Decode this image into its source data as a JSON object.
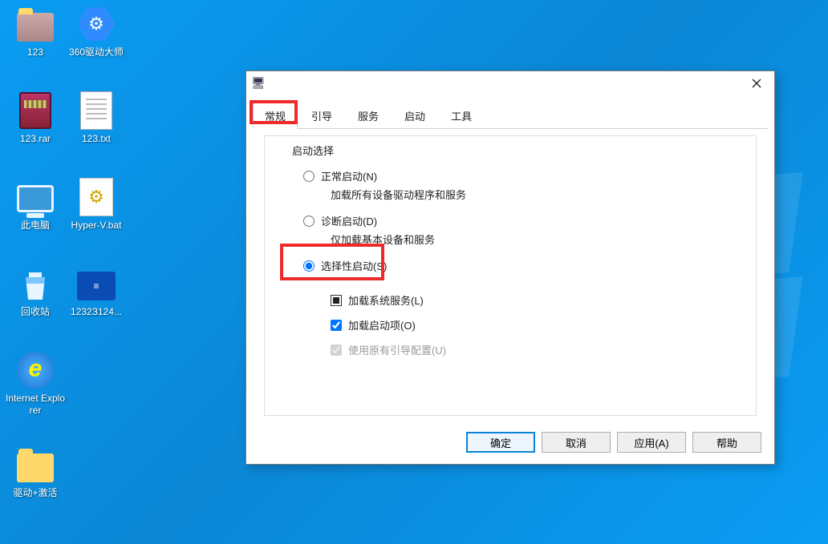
{
  "desktop_icons": {
    "folder123": "123",
    "driver360": "360驱动大师",
    "rar": "123.rar",
    "txt": "123.txt",
    "thispc": "此电脑",
    "hyperv": "Hyper-V.bat",
    "recycle": "回收站",
    "shortcut": "1232З124...",
    "ie": "Internet Explorer",
    "activate": "驱动+激活"
  },
  "dialog": {
    "tabs": {
      "general": "常规",
      "boot": "引导",
      "services": "服务",
      "startup": "启动",
      "tools": "工具"
    },
    "group_title": "启动选择",
    "opt_normal": "正常启动(N)",
    "opt_normal_desc": "加载所有设备驱动程序和服务",
    "opt_diag": "诊断启动(D)",
    "opt_diag_desc": "仅加载基本设备和服务",
    "opt_selective": "选择性启动(S)",
    "chk_sys": "加载系统服务(L)",
    "chk_startup": "加载启动项(O)",
    "chk_boot": "使用原有引导配置(U)",
    "buttons": {
      "ok": "确定",
      "cancel": "取消",
      "apply": "应用(A)",
      "help": "帮助"
    }
  }
}
